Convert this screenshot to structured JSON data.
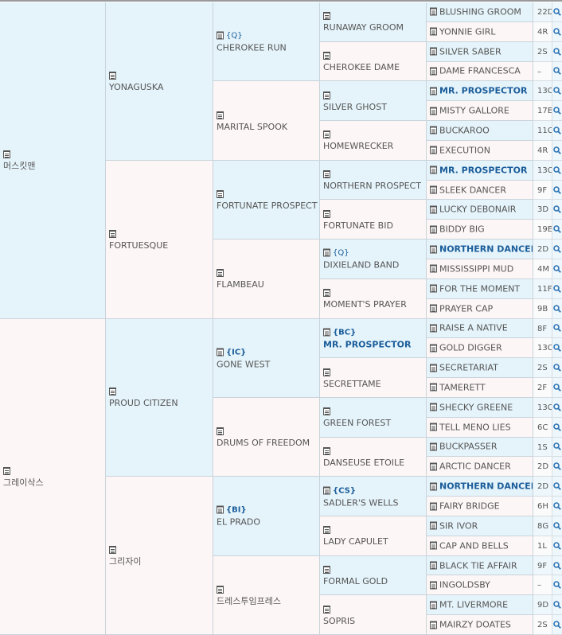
{
  "gen1": [
    {
      "name": "머스킷맨",
      "sex": "male"
    },
    {
      "name": "그레이삭스",
      "sex": "female"
    }
  ],
  "gen2": [
    {
      "name": "YONAGUSKA",
      "sex": "male"
    },
    {
      "name": "FORTUESQUE",
      "sex": "female"
    },
    {
      "name": "PROUD CITIZEN",
      "sex": "male"
    },
    {
      "name": "그리자이",
      "sex": "female"
    }
  ],
  "gen3": [
    {
      "name": "CHEROKEE RUN",
      "sex": "male",
      "tag": "{Q}",
      "tag_bold": false
    },
    {
      "name": "MARITAL SPOOK",
      "sex": "female"
    },
    {
      "name": "FORTUNATE PROSPECT",
      "sex": "male"
    },
    {
      "name": "FLAMBEAU",
      "sex": "female"
    },
    {
      "name": "GONE WEST",
      "sex": "male",
      "tag": "{IC}",
      "tag_bold": true
    },
    {
      "name": "DRUMS OF FREEDOM",
      "sex": "female"
    },
    {
      "name": "EL PRADO",
      "sex": "male",
      "tag": "{BI}",
      "tag_bold": true
    },
    {
      "name": "드레스투임프레스",
      "sex": "female"
    }
  ],
  "gen4": [
    {
      "name": "RUNAWAY GROOM",
      "sex": "male"
    },
    {
      "name": "CHEROKEE DAME",
      "sex": "female"
    },
    {
      "name": "SILVER GHOST",
      "sex": "male"
    },
    {
      "name": "HOMEWRECKER",
      "sex": "female"
    },
    {
      "name": "NORTHERN PROSPECT",
      "sex": "male"
    },
    {
      "name": "FORTUNATE BID",
      "sex": "female"
    },
    {
      "name": "DIXIELAND BAND",
      "sex": "male",
      "tag": "{Q}",
      "tag_bold": false
    },
    {
      "name": "MOMENT'S PRAYER",
      "sex": "female"
    },
    {
      "name": "MR. PROSPECTOR",
      "sex": "male",
      "tag": "{BC}",
      "tag_bold": true,
      "bold": true
    },
    {
      "name": "SECRETTAME",
      "sex": "female"
    },
    {
      "name": "GREEN FOREST",
      "sex": "male"
    },
    {
      "name": "DANSEUSE ETOILE",
      "sex": "female"
    },
    {
      "name": "SADLER'S WELLS",
      "sex": "male",
      "tag": "{CS}",
      "tag_bold": true
    },
    {
      "name": "LADY CAPULET",
      "sex": "female"
    },
    {
      "name": "FORMAL GOLD",
      "sex": "male"
    },
    {
      "name": "SOPRIS",
      "sex": "female"
    }
  ],
  "gen5": [
    {
      "name": "BLUSHING GROOM",
      "code": "22D",
      "sex": "male"
    },
    {
      "name": "YONNIE GIRL",
      "code": "4R",
      "sex": "female"
    },
    {
      "name": "SILVER SABER",
      "code": "2S",
      "sex": "male"
    },
    {
      "name": "DAME FRANCESCA",
      "code": "–",
      "sex": "female"
    },
    {
      "name": "MR. PROSPECTOR",
      "code": "13C",
      "sex": "male",
      "bold": true
    },
    {
      "name": "MISTY GALLORE",
      "code": "17E",
      "sex": "female"
    },
    {
      "name": "BUCKAROO",
      "code": "11C",
      "sex": "male"
    },
    {
      "name": "EXECUTION",
      "code": "4R",
      "sex": "female"
    },
    {
      "name": "MR. PROSPECTOR",
      "code": "13C",
      "sex": "male",
      "bold": true
    },
    {
      "name": "SLEEK DANCER",
      "code": "9F",
      "sex": "female"
    },
    {
      "name": "LUCKY DEBONAIR",
      "code": "3D",
      "sex": "male"
    },
    {
      "name": "BIDDY BIG",
      "code": "19E",
      "sex": "female"
    },
    {
      "name": "NORTHERN DANCER",
      "code": "2D",
      "sex": "male",
      "bold": true
    },
    {
      "name": "MISSISSIPPI MUD",
      "code": "4M",
      "sex": "female"
    },
    {
      "name": "FOR THE MOMENT",
      "code": "11F",
      "sex": "male"
    },
    {
      "name": "PRAYER CAP",
      "code": "9B",
      "sex": "female"
    },
    {
      "name": "RAISE A NATIVE",
      "code": "8F",
      "sex": "male"
    },
    {
      "name": "GOLD DIGGER",
      "code": "13C",
      "sex": "female"
    },
    {
      "name": "SECRETARIAT",
      "code": "2S",
      "sex": "male"
    },
    {
      "name": "TAMERETT",
      "code": "2F",
      "sex": "female"
    },
    {
      "name": "SHECKY GREENE",
      "code": "13C",
      "sex": "male"
    },
    {
      "name": "TELL MENO LIES",
      "code": "6C",
      "sex": "female"
    },
    {
      "name": "BUCKPASSER",
      "code": "1S",
      "sex": "male"
    },
    {
      "name": "ARCTIC DANCER",
      "code": "2D",
      "sex": "female"
    },
    {
      "name": "NORTHERN DANCER",
      "code": "2D",
      "sex": "male",
      "bold": true
    },
    {
      "name": "FAIRY BRIDGE",
      "code": "6H",
      "sex": "female"
    },
    {
      "name": "SIR IVOR",
      "code": "8G",
      "sex": "male"
    },
    {
      "name": "CAP AND BELLS",
      "code": "1L",
      "sex": "female"
    },
    {
      "name": "BLACK TIE AFFAIR",
      "code": "9F",
      "sex": "male"
    },
    {
      "name": "INGOLDSBY",
      "code": "–",
      "sex": "female"
    },
    {
      "name": "MT. LIVERMORE",
      "code": "9D",
      "sex": "male"
    },
    {
      "name": "MAIRZY DOATES",
      "code": "2S",
      "sex": "female"
    }
  ],
  "colors": {
    "male_bg": "#e5f4fb",
    "female_bg": "#fdf6f6",
    "highlight": "#1b5d9a",
    "search_icon": "#2f74b5"
  },
  "icons": {
    "record": "clipboard-icon",
    "search": "search-icon"
  }
}
